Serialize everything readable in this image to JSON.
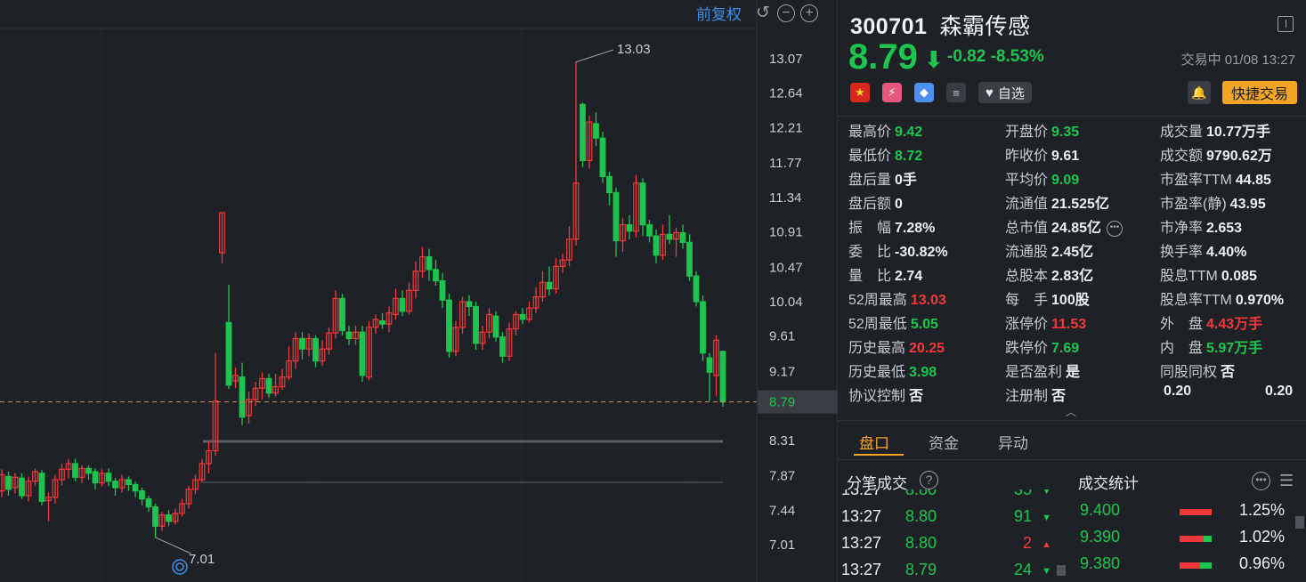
{
  "chart": {
    "adjust_label": "前复权",
    "y_ticks": [
      "13.07",
      "12.64",
      "12.21",
      "11.77",
      "11.34",
      "10.91",
      "10.47",
      "10.04",
      "9.61",
      "9.17",
      "8.79",
      "8.31",
      "7.87",
      "7.44",
      "7.01"
    ],
    "current_price_tag": "8.79",
    "high_label": "13.03",
    "low_label": "7.01",
    "candles": [
      [
        7.68,
        7.88,
        7.95,
        7.6
      ],
      [
        7.86,
        7.7,
        7.92,
        7.62
      ],
      [
        7.72,
        7.85,
        7.9,
        7.65
      ],
      [
        7.84,
        7.62,
        7.9,
        7.58
      ],
      [
        7.62,
        7.8,
        7.86,
        7.55
      ],
      [
        7.8,
        7.92,
        7.96,
        7.74
      ],
      [
        7.9,
        7.55,
        7.94,
        7.5
      ],
      [
        7.56,
        7.6,
        7.66,
        7.3
      ],
      [
        7.6,
        7.82,
        7.88,
        7.52
      ],
      [
        7.82,
        7.95,
        8.02,
        7.75
      ],
      [
        7.95,
        8.02,
        8.08,
        7.84
      ],
      [
        8.02,
        7.85,
        8.08,
        7.8
      ],
      [
        7.85,
        7.96,
        8.0,
        7.78
      ],
      [
        7.96,
        7.9,
        8.0,
        7.82
      ],
      [
        7.92,
        7.78,
        7.96,
        7.7
      ],
      [
        7.78,
        7.9,
        7.95,
        7.74
      ],
      [
        7.9,
        7.8,
        7.96,
        7.74
      ],
      [
        7.8,
        7.72,
        7.84,
        7.62
      ],
      [
        7.72,
        7.82,
        7.88,
        7.66
      ],
      [
        7.82,
        7.76,
        7.86,
        7.68
      ],
      [
        7.76,
        7.68,
        7.8,
        7.6
      ],
      [
        7.68,
        7.58,
        7.72,
        7.5
      ],
      [
        7.58,
        7.48,
        7.62,
        7.42
      ],
      [
        7.48,
        7.24,
        7.52,
        7.1
      ],
      [
        7.24,
        7.38,
        7.42,
        7.18
      ],
      [
        7.38,
        7.3,
        7.44,
        7.24
      ],
      [
        7.3,
        7.4,
        7.46,
        7.26
      ],
      [
        7.4,
        7.52,
        7.58,
        7.36
      ],
      [
        7.52,
        7.7,
        7.74,
        7.46
      ],
      [
        7.7,
        7.82,
        7.88,
        7.64
      ],
      [
        7.82,
        8.02,
        8.08,
        7.78
      ],
      [
        8.02,
        8.18,
        8.3,
        7.9
      ],
      [
        8.18,
        8.8,
        9.4,
        8.12
      ],
      [
        10.65,
        11.15,
        11.15,
        10.52
      ],
      [
        9.78,
        9.0,
        10.25,
        8.95
      ],
      [
        9.05,
        9.12,
        9.22,
        8.96
      ],
      [
        9.1,
        8.6,
        9.28,
        8.5
      ],
      [
        8.62,
        8.82,
        8.92,
        8.52
      ],
      [
        8.82,
        8.96,
        9.04,
        8.74
      ],
      [
        8.96,
        9.08,
        9.16,
        8.82
      ],
      [
        9.08,
        8.9,
        9.14,
        8.84
      ],
      [
        8.9,
        8.98,
        9.14,
        8.86
      ],
      [
        8.98,
        9.1,
        9.2,
        8.94
      ],
      [
        9.1,
        9.3,
        9.48,
        9.06
      ],
      [
        9.3,
        9.58,
        9.66,
        9.2
      ],
      [
        9.58,
        9.45,
        9.66,
        9.32
      ],
      [
        9.45,
        9.58,
        9.64,
        9.36
      ],
      [
        9.58,
        9.3,
        9.62,
        9.22
      ],
      [
        9.3,
        9.45,
        9.56,
        9.24
      ],
      [
        9.45,
        9.65,
        9.72,
        9.38
      ],
      [
        9.65,
        10.08,
        10.18,
        9.58
      ],
      [
        10.08,
        9.68,
        10.14,
        9.62
      ],
      [
        9.66,
        9.58,
        9.74,
        9.5
      ],
      [
        9.58,
        9.66,
        9.74,
        9.5
      ],
      [
        9.66,
        9.12,
        9.74,
        9.04
      ],
      [
        9.1,
        9.72,
        9.8,
        9.06
      ],
      [
        9.72,
        9.82,
        9.88,
        9.64
      ],
      [
        9.8,
        9.76,
        9.9,
        9.7
      ],
      [
        9.76,
        9.9,
        9.98,
        9.66
      ],
      [
        9.88,
        10.08,
        10.2,
        9.82
      ],
      [
        10.08,
        9.92,
        10.18,
        9.86
      ],
      [
        9.92,
        10.18,
        10.28,
        9.88
      ],
      [
        10.18,
        10.42,
        10.54,
        10.08
      ],
      [
        10.42,
        10.6,
        10.72,
        10.34
      ],
      [
        10.6,
        10.44,
        10.7,
        10.3
      ],
      [
        10.44,
        10.3,
        10.56,
        10.24
      ],
      [
        10.3,
        10.06,
        10.4,
        9.96
      ],
      [
        10.06,
        9.42,
        10.14,
        9.34
      ],
      [
        9.42,
        9.72,
        9.8,
        9.36
      ],
      [
        9.72,
        10.04,
        10.1,
        9.64
      ],
      [
        10.04,
        9.98,
        10.12,
        9.86
      ],
      [
        9.98,
        9.52,
        10.04,
        9.44
      ],
      [
        9.52,
        9.66,
        9.74,
        9.44
      ],
      [
        9.66,
        9.88,
        9.96,
        9.58
      ],
      [
        9.86,
        9.6,
        9.92,
        9.54
      ],
      [
        9.6,
        9.36,
        9.66,
        9.28
      ],
      [
        9.36,
        9.7,
        9.78,
        9.3
      ],
      [
        9.7,
        9.88,
        9.92,
        9.62
      ],
      [
        9.88,
        9.82,
        9.96,
        9.76
      ],
      [
        9.82,
        9.96,
        10.04,
        9.78
      ],
      [
        9.96,
        10.1,
        10.22,
        9.9
      ],
      [
        10.1,
        10.28,
        10.42,
        10.04
      ],
      [
        10.28,
        10.2,
        10.48,
        10.12
      ],
      [
        10.2,
        10.48,
        10.58,
        10.14
      ],
      [
        10.48,
        10.56,
        10.64,
        10.4
      ],
      [
        10.56,
        10.82,
        10.98,
        10.48
      ],
      [
        10.82,
        11.52,
        13.03,
        10.74
      ],
      [
        12.5,
        11.8,
        12.52,
        11.72
      ],
      [
        11.8,
        12.28,
        12.36,
        11.7
      ],
      [
        12.26,
        12.08,
        12.4,
        11.98
      ],
      [
        12.08,
        11.6,
        12.16,
        11.52
      ],
      [
        11.6,
        11.4,
        11.66,
        11.24
      ],
      [
        11.4,
        10.8,
        11.46,
        10.6
      ],
      [
        10.8,
        11.0,
        11.08,
        10.66
      ],
      [
        11.0,
        10.92,
        11.12,
        10.82
      ],
      [
        10.92,
        11.52,
        11.62,
        10.84
      ],
      [
        11.52,
        11.0,
        11.58,
        10.86
      ],
      [
        11.0,
        10.86,
        11.06,
        10.78
      ],
      [
        10.86,
        10.62,
        10.94,
        10.52
      ],
      [
        10.62,
        10.88,
        11.0,
        10.56
      ],
      [
        10.88,
        10.82,
        11.12,
        10.76
      ],
      [
        10.82,
        10.9,
        10.96,
        10.6
      ],
      [
        10.9,
        10.78,
        11.0,
        10.7
      ],
      [
        10.78,
        10.36,
        10.88,
        10.3
      ],
      [
        10.36,
        10.04,
        10.42,
        9.98
      ],
      [
        10.04,
        9.4,
        10.12,
        9.3
      ],
      [
        9.34,
        9.16,
        9.4,
        8.8
      ],
      [
        9.12,
        9.56,
        9.62,
        8.86
      ],
      [
        9.42,
        8.79,
        9.43,
        8.73
      ]
    ]
  },
  "quote": {
    "code": "300701",
    "name": "森霸传感",
    "price": "8.79",
    "arrow": "⬇",
    "change": "-0.82",
    "change_pct": "-8.53%",
    "status": "交易中 01/08 13:27",
    "watch_label": "自选",
    "quick_trade_label": "快捷交易"
  },
  "fields": [
    [
      {
        "l": "最高价",
        "v": "9.42",
        "c": "g"
      },
      {
        "l": "开盘价",
        "v": "9.35",
        "c": "g"
      },
      {
        "l": "成交量",
        "v": "10.77万手",
        "c": "w"
      }
    ],
    [
      {
        "l": "最低价",
        "v": "8.72",
        "c": "g"
      },
      {
        "l": "昨收价",
        "v": "9.61",
        "c": "w"
      },
      {
        "l": "成交额",
        "v": "9790.62万",
        "c": "w"
      }
    ],
    [
      {
        "l": "盘后量",
        "v": "0手",
        "c": "w"
      },
      {
        "l": "平均价",
        "v": "9.09",
        "c": "g"
      },
      {
        "l": "市盈率TTM",
        "v": "44.85",
        "c": "w"
      }
    ],
    [
      {
        "l": "盘后额",
        "v": "0",
        "c": "w"
      },
      {
        "l": "流通值",
        "v": "21.525亿",
        "c": "w"
      },
      {
        "l": "市盈率(静)",
        "v": "43.95",
        "c": "w"
      }
    ],
    [
      {
        "l": "振　幅",
        "v": "7.28%",
        "c": "w"
      },
      {
        "l": "总市值",
        "v": "24.85亿",
        "c": "w",
        "more": true
      },
      {
        "l": "市净率",
        "v": "2.653",
        "c": "w"
      }
    ],
    [
      {
        "l": "委　比",
        "v": "-30.82%",
        "c": "w"
      },
      {
        "l": "流通股",
        "v": "2.45亿",
        "c": "w"
      },
      {
        "l": "换手率",
        "v": "4.40%",
        "c": "w"
      }
    ],
    [
      {
        "l": "量　比",
        "v": "2.74",
        "c": "w"
      },
      {
        "l": "总股本",
        "v": "2.83亿",
        "c": "w"
      },
      {
        "l": "股息TTM",
        "v": "0.085",
        "c": "w"
      }
    ],
    [
      {
        "l": "52周最高",
        "v": "13.03",
        "c": "r"
      },
      {
        "l": "每　手",
        "v": "100股",
        "c": "w"
      },
      {
        "l": "股息率TTM",
        "v": "0.970%",
        "c": "w"
      }
    ],
    [
      {
        "l": "52周最低",
        "v": "5.05",
        "c": "g"
      },
      {
        "l": "涨停价",
        "v": "11.53",
        "c": "r"
      },
      {
        "l": "外　盘",
        "v": "4.43万手",
        "c": "r"
      }
    ],
    [
      {
        "l": "历史最高",
        "v": "20.25",
        "c": "r"
      },
      {
        "l": "跌停价",
        "v": "7.69",
        "c": "g"
      },
      {
        "l": "内　盘",
        "v": "5.97万手",
        "c": "g"
      }
    ],
    [
      {
        "l": "历史最低",
        "v": "3.98",
        "c": "g"
      },
      {
        "l": "是否盈利",
        "v": "是",
        "c": "w"
      },
      {
        "l": "同股同权",
        "v": "否",
        "c": "w"
      }
    ],
    [
      {
        "l": "协议控制",
        "v": "否",
        "c": "w"
      },
      {
        "l": "注册制",
        "v": "否",
        "c": "w"
      },
      {
        "l": "",
        "v": "0.20",
        "c": "w",
        "pair": "0.20"
      }
    ]
  ],
  "tabs": [
    "盘口",
    "资金",
    "异动"
  ],
  "ticks_title": "分笔成交",
  "stats_title": "成交统计",
  "ticks": [
    {
      "t": "13:27",
      "p": "8.80",
      "v": "35",
      "dir": "down"
    },
    {
      "t": "13:27",
      "p": "8.80",
      "v": "91",
      "dir": "down"
    },
    {
      "t": "13:27",
      "p": "8.80",
      "v": "2",
      "dir": "up"
    },
    {
      "t": "13:27",
      "p": "8.79",
      "v": "24",
      "dir": "down"
    }
  ],
  "stats": [
    {
      "p": "9.400",
      "pct": "1.25%",
      "green": 0
    },
    {
      "p": "9.390",
      "pct": "1.02%",
      "green": 0.25
    },
    {
      "p": "9.380",
      "pct": "0.96%",
      "green": 0.35
    }
  ],
  "colors": {
    "up": "#f0383c",
    "down": "#1dc44f",
    "accent": "#f5a524",
    "link": "#3d8ee6"
  }
}
